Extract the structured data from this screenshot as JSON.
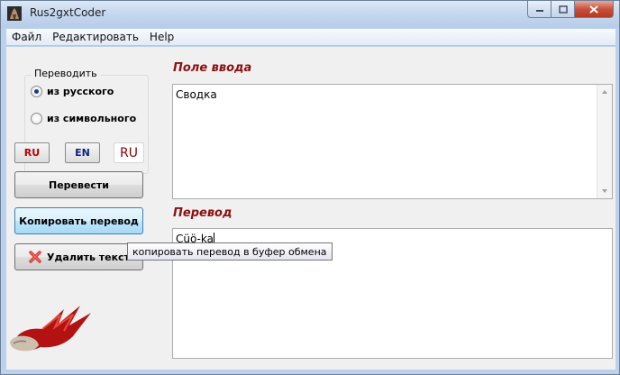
{
  "window": {
    "title": "Rus2gxtCoder"
  },
  "menu": {
    "items": [
      "Файл",
      "Редактировать",
      "Help"
    ]
  },
  "direction": {
    "label": "Переводить",
    "options": [
      {
        "label": "из русского",
        "checked": true
      },
      {
        "label": "из символьного",
        "checked": false
      }
    ]
  },
  "lang_buttons": {
    "ru_boxed": "RU",
    "en_boxed": "EN",
    "ru_plain": "RU",
    "ru_color": "#c00000",
    "en_color": "#102080",
    "ru_plain_color": "#8b0000"
  },
  "actions": {
    "translate": "Перевести",
    "copy": "Копировать перевод",
    "delete": "Удалить текст"
  },
  "input": {
    "label": "Поле ввода",
    "value": "Сводка"
  },
  "output": {
    "label": "Перевод",
    "value": "Cüö-ka"
  },
  "tooltip": {
    "text": "копировать перевод в буфер обмена"
  },
  "icons": {
    "app": "game-figure-icon",
    "delete": "red-x-icon",
    "logo": "red-flame-hand-logo"
  }
}
